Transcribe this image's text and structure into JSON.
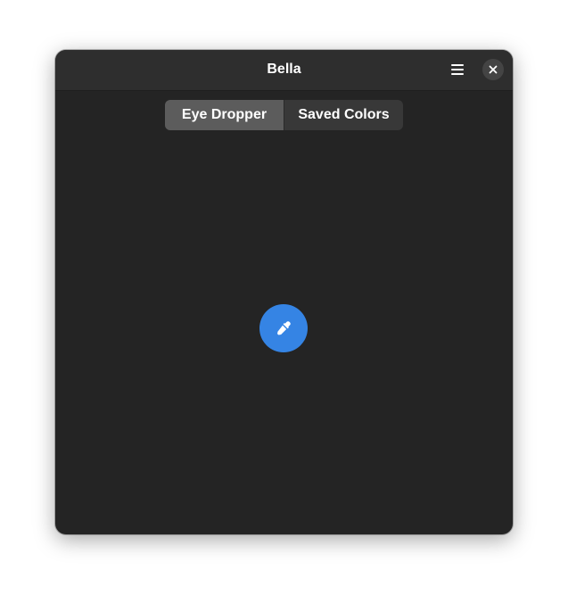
{
  "window": {
    "title": "Bella"
  },
  "header": {
    "menu_icon": "hamburger-menu-icon",
    "close_icon": "close-icon"
  },
  "view_switcher": {
    "tabs": [
      {
        "label": "Eye Dropper",
        "active": true
      },
      {
        "label": "Saved Colors",
        "active": false
      }
    ]
  },
  "main": {
    "picker_icon": "eyedropper-icon"
  },
  "colors": {
    "window_bg": "#242424",
    "headerbar_bg": "#2e2e2e",
    "accent": "#3584e4",
    "active_tab_bg": "#5c5c5c",
    "switcher_bg": "#383838"
  }
}
